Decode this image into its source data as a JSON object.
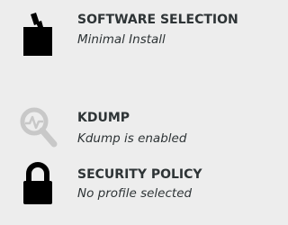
{
  "spokes": [
    {
      "id": "software-selection",
      "icon": "package-icon",
      "title": "SOFTWARE SELECTION",
      "status": "Minimal Install"
    },
    {
      "id": "kdump",
      "icon": "kdump-icon",
      "title": "KDUMP",
      "status": "Kdump is enabled"
    },
    {
      "id": "security-policy",
      "icon": "lock-icon",
      "title": "SECURITY POLICY",
      "status": "No profile selected"
    }
  ],
  "colors": {
    "background": "#ededed",
    "text": "#2e3436",
    "icon_dark": "#000000",
    "icon_light": "#c8c8c8"
  }
}
